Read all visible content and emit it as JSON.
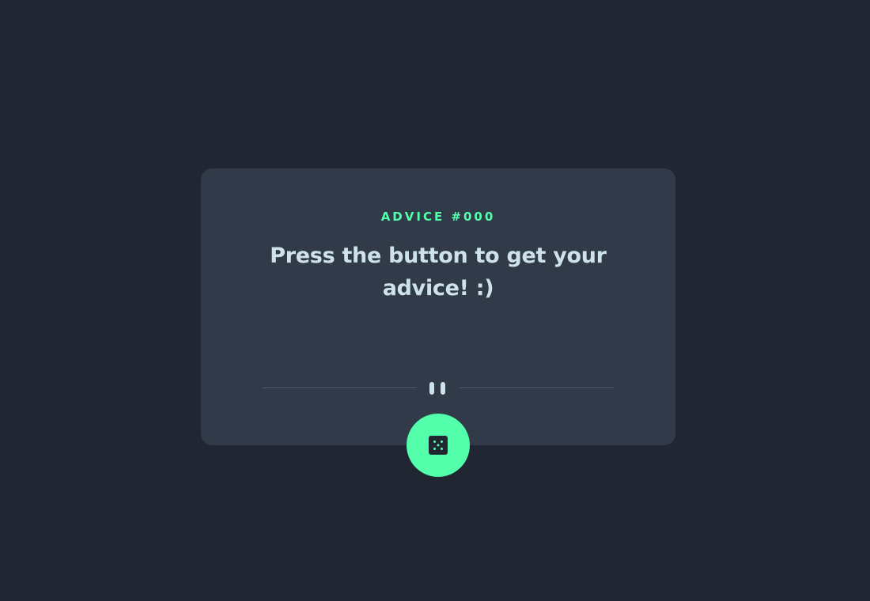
{
  "card": {
    "advice_label": "ADVICE #000",
    "quote": "Press the button to get your advice! :)"
  },
  "divider": {
    "icon": "pause-icon"
  },
  "button": {
    "icon": "dice-icon"
  },
  "colors": {
    "background": "#202632",
    "card": "#313A49",
    "accent": "#53FFAA",
    "text": "#CEE3E9",
    "divider": "#4F5D74"
  }
}
